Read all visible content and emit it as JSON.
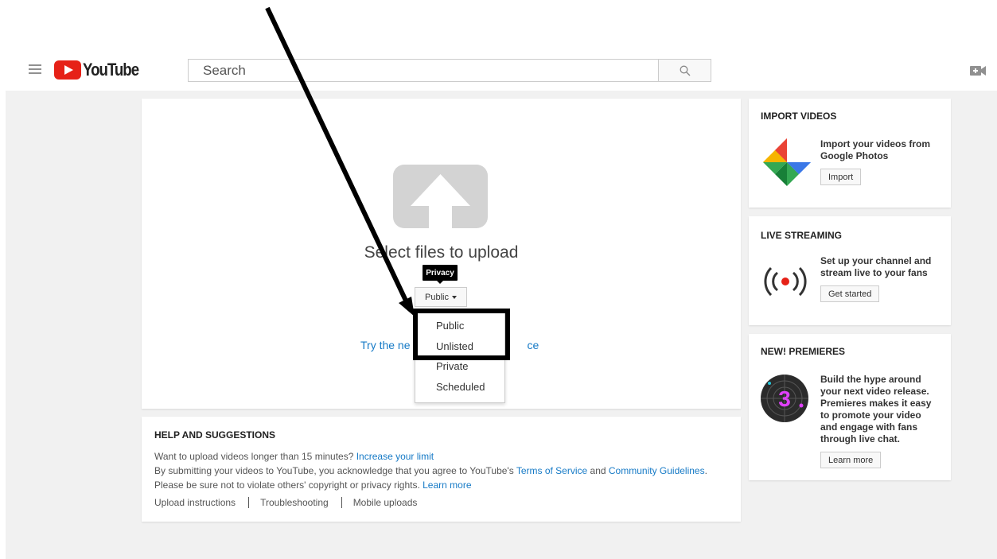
{
  "header": {
    "logo_text": "YouTube",
    "search_placeholder": "Search"
  },
  "upload": {
    "select_files": "Select files to upload",
    "privacy_tooltip": "Privacy",
    "privacy_selected": "Public",
    "privacy_options": [
      "Public",
      "Unlisted",
      "Private",
      "Scheduled"
    ],
    "try_new_prefix": "Try the ne",
    "try_new_suffix": "ce"
  },
  "help": {
    "title": "HELP AND SUGGESTIONS",
    "line1_text": "Want to upload videos longer than 15 minutes? ",
    "line1_link": "Increase your limit",
    "line2_text": "By submitting your videos to YouTube, you acknowledge that you agree to YouTube's ",
    "line2_link1": "Terms of Service",
    "line2_mid": " and ",
    "line2_link2": "Community Guidelines",
    "line2_end": ".",
    "line3_text": "Please be sure not to violate others' copyright or privacy rights. ",
    "line3_link": "Learn more",
    "links": [
      "Upload instructions",
      "Troubleshooting",
      "Mobile uploads"
    ]
  },
  "sidebar": {
    "import": {
      "title": "IMPORT VIDEOS",
      "text_line1": "Import your videos from",
      "text_line2": "Google Photos",
      "button": "Import"
    },
    "live": {
      "title": "LIVE STREAMING",
      "text_line1": "Set up your channel and",
      "text_line2": "stream live to your fans",
      "button": "Get started"
    },
    "premieres": {
      "title": "NEW! PREMIERES",
      "text_lines": [
        "Build the hype around",
        "your next video release.",
        "Premieres makes it easy",
        "to promote your video",
        "and engage with fans",
        "through live chat."
      ],
      "icon_number": "3",
      "button": "Learn more"
    }
  },
  "colors": {
    "brand_red": "#e62117",
    "link_blue": "#167ac6",
    "page_bg": "#f1f1f1"
  }
}
